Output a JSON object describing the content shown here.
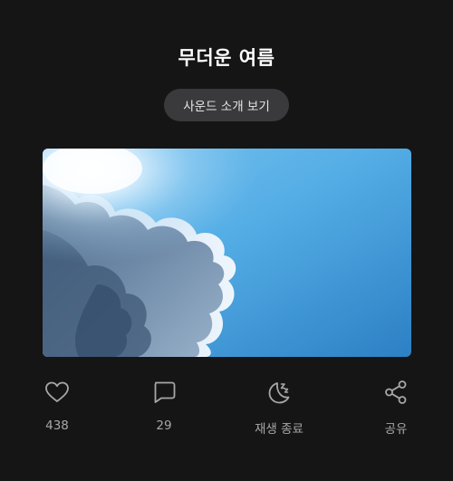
{
  "page": {
    "title": "무더운 여름",
    "intro_button_label": "사운드 소개 보기"
  },
  "artwork": {
    "description_icon": "sky-clouds-image"
  },
  "actions": {
    "like": {
      "icon": "heart-icon",
      "label": "438"
    },
    "comment": {
      "icon": "speech-bubble-icon",
      "label": "29"
    },
    "sleep_timer": {
      "icon": "moon-zz-icon",
      "label": "재생 종료"
    },
    "share": {
      "icon": "share-icon",
      "label": "공유"
    }
  },
  "colors": {
    "background": "#161516",
    "button_bg": "#3a393b",
    "icon": "#a7a6a8",
    "sky_top": "#5fb3e6",
    "sky_bottom": "#2f86c8"
  }
}
